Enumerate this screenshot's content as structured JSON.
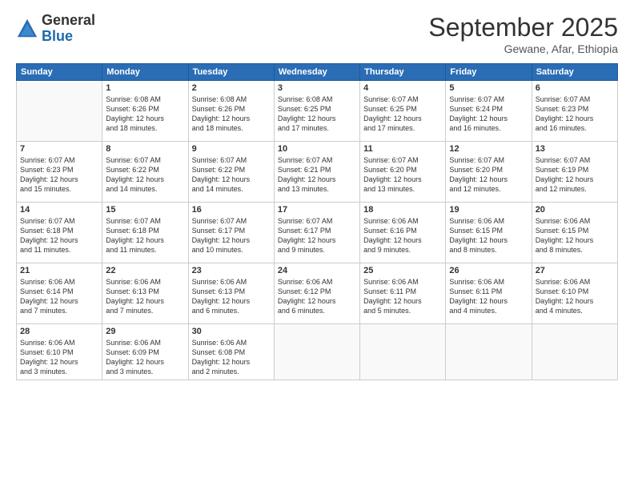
{
  "header": {
    "logo": {
      "general": "General",
      "blue": "Blue"
    },
    "title": "September 2025",
    "subtitle": "Gewane, Afar, Ethiopia"
  },
  "calendar": {
    "days_of_week": [
      "Sunday",
      "Monday",
      "Tuesday",
      "Wednesday",
      "Thursday",
      "Friday",
      "Saturday"
    ],
    "weeks": [
      [
        {
          "day": "",
          "detail": ""
        },
        {
          "day": "1",
          "detail": "Sunrise: 6:08 AM\nSunset: 6:26 PM\nDaylight: 12 hours\nand 18 minutes."
        },
        {
          "day": "2",
          "detail": "Sunrise: 6:08 AM\nSunset: 6:26 PM\nDaylight: 12 hours\nand 18 minutes."
        },
        {
          "day": "3",
          "detail": "Sunrise: 6:08 AM\nSunset: 6:25 PM\nDaylight: 12 hours\nand 17 minutes."
        },
        {
          "day": "4",
          "detail": "Sunrise: 6:07 AM\nSunset: 6:25 PM\nDaylight: 12 hours\nand 17 minutes."
        },
        {
          "day": "5",
          "detail": "Sunrise: 6:07 AM\nSunset: 6:24 PM\nDaylight: 12 hours\nand 16 minutes."
        },
        {
          "day": "6",
          "detail": "Sunrise: 6:07 AM\nSunset: 6:23 PM\nDaylight: 12 hours\nand 16 minutes."
        }
      ],
      [
        {
          "day": "7",
          "detail": "Sunrise: 6:07 AM\nSunset: 6:23 PM\nDaylight: 12 hours\nand 15 minutes."
        },
        {
          "day": "8",
          "detail": "Sunrise: 6:07 AM\nSunset: 6:22 PM\nDaylight: 12 hours\nand 14 minutes."
        },
        {
          "day": "9",
          "detail": "Sunrise: 6:07 AM\nSunset: 6:22 PM\nDaylight: 12 hours\nand 14 minutes."
        },
        {
          "day": "10",
          "detail": "Sunrise: 6:07 AM\nSunset: 6:21 PM\nDaylight: 12 hours\nand 13 minutes."
        },
        {
          "day": "11",
          "detail": "Sunrise: 6:07 AM\nSunset: 6:20 PM\nDaylight: 12 hours\nand 13 minutes."
        },
        {
          "day": "12",
          "detail": "Sunrise: 6:07 AM\nSunset: 6:20 PM\nDaylight: 12 hours\nand 12 minutes."
        },
        {
          "day": "13",
          "detail": "Sunrise: 6:07 AM\nSunset: 6:19 PM\nDaylight: 12 hours\nand 12 minutes."
        }
      ],
      [
        {
          "day": "14",
          "detail": "Sunrise: 6:07 AM\nSunset: 6:18 PM\nDaylight: 12 hours\nand 11 minutes."
        },
        {
          "day": "15",
          "detail": "Sunrise: 6:07 AM\nSunset: 6:18 PM\nDaylight: 12 hours\nand 11 minutes."
        },
        {
          "day": "16",
          "detail": "Sunrise: 6:07 AM\nSunset: 6:17 PM\nDaylight: 12 hours\nand 10 minutes."
        },
        {
          "day": "17",
          "detail": "Sunrise: 6:07 AM\nSunset: 6:17 PM\nDaylight: 12 hours\nand 9 minutes."
        },
        {
          "day": "18",
          "detail": "Sunrise: 6:06 AM\nSunset: 6:16 PM\nDaylight: 12 hours\nand 9 minutes."
        },
        {
          "day": "19",
          "detail": "Sunrise: 6:06 AM\nSunset: 6:15 PM\nDaylight: 12 hours\nand 8 minutes."
        },
        {
          "day": "20",
          "detail": "Sunrise: 6:06 AM\nSunset: 6:15 PM\nDaylight: 12 hours\nand 8 minutes."
        }
      ],
      [
        {
          "day": "21",
          "detail": "Sunrise: 6:06 AM\nSunset: 6:14 PM\nDaylight: 12 hours\nand 7 minutes."
        },
        {
          "day": "22",
          "detail": "Sunrise: 6:06 AM\nSunset: 6:13 PM\nDaylight: 12 hours\nand 7 minutes."
        },
        {
          "day": "23",
          "detail": "Sunrise: 6:06 AM\nSunset: 6:13 PM\nDaylight: 12 hours\nand 6 minutes."
        },
        {
          "day": "24",
          "detail": "Sunrise: 6:06 AM\nSunset: 6:12 PM\nDaylight: 12 hours\nand 6 minutes."
        },
        {
          "day": "25",
          "detail": "Sunrise: 6:06 AM\nSunset: 6:11 PM\nDaylight: 12 hours\nand 5 minutes."
        },
        {
          "day": "26",
          "detail": "Sunrise: 6:06 AM\nSunset: 6:11 PM\nDaylight: 12 hours\nand 4 minutes."
        },
        {
          "day": "27",
          "detail": "Sunrise: 6:06 AM\nSunset: 6:10 PM\nDaylight: 12 hours\nand 4 minutes."
        }
      ],
      [
        {
          "day": "28",
          "detail": "Sunrise: 6:06 AM\nSunset: 6:10 PM\nDaylight: 12 hours\nand 3 minutes."
        },
        {
          "day": "29",
          "detail": "Sunrise: 6:06 AM\nSunset: 6:09 PM\nDaylight: 12 hours\nand 3 minutes."
        },
        {
          "day": "30",
          "detail": "Sunrise: 6:06 AM\nSunset: 6:08 PM\nDaylight: 12 hours\nand 2 minutes."
        },
        {
          "day": "",
          "detail": ""
        },
        {
          "day": "",
          "detail": ""
        },
        {
          "day": "",
          "detail": ""
        },
        {
          "day": "",
          "detail": ""
        }
      ]
    ]
  }
}
